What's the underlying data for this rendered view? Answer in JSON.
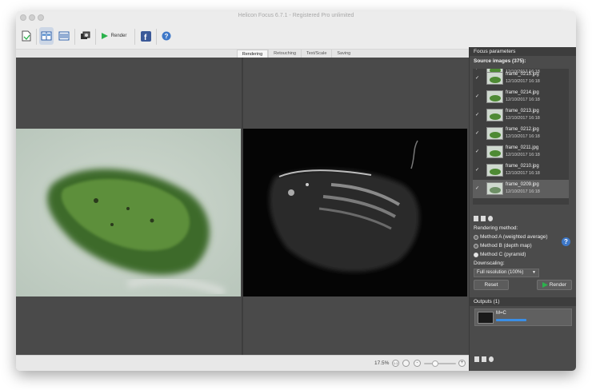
{
  "window": {
    "title": "Helicon Focus 6.7.1 - Registered Pro unlimited"
  },
  "toolbar": {
    "render_label": "Render"
  },
  "tabs": [
    {
      "label": "Rendering",
      "active": true
    },
    {
      "label": "Retouching",
      "active": false
    },
    {
      "label": "Text/Scale",
      "active": false
    },
    {
      "label": "Saving",
      "active": false
    }
  ],
  "status": {
    "zoom": "17.5%",
    "zoom_fit": "1:1",
    "zoom_out": "-",
    "zoom_in": "+"
  },
  "panel": {
    "header": "Focus parameters",
    "source_label": "Source images (375):",
    "items": [
      {
        "name": "",
        "date": "12/10/2017 16:18"
      },
      {
        "name": "frame_0215.jpg",
        "date": "12/10/2017 16:18"
      },
      {
        "name": "frame_0214.jpg",
        "date": "12/10/2017 16:18"
      },
      {
        "name": "frame_0213.jpg",
        "date": "12/10/2017 16:18"
      },
      {
        "name": "frame_0212.jpg",
        "date": "12/10/2017 16:18"
      },
      {
        "name": "frame_0211.jpg",
        "date": "12/10/2017 16:18"
      },
      {
        "name": "frame_0210.jpg",
        "date": "12/10/2017 16:18"
      },
      {
        "name": "frame_0209.jpg",
        "date": "12/10/2017 16:18"
      }
    ],
    "method_label": "Rendering method:",
    "methods": [
      "Method A (weighted average)",
      "Method B (depth map)",
      "Method C (pyramid)"
    ],
    "selected_method_index": 2,
    "downscaling_label": "Downscaling:",
    "downscaling_value": "Full resolution (100%)",
    "reset_label": "Reset",
    "render_label": "Render",
    "outputs_label": "Outputs (1)",
    "output_name": "M=C",
    "output_progress": 1.0
  },
  "colors": {
    "accent": "#3a8ee6",
    "help": "#3e78c8",
    "render_green": "#2bb24c"
  }
}
